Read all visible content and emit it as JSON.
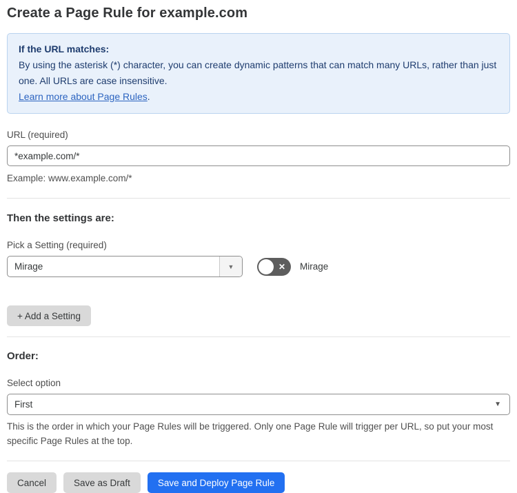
{
  "page": {
    "title": "Create a Page Rule for example.com"
  },
  "info_box": {
    "heading": "If the URL matches:",
    "body": "By using the asterisk (*) character, you can create dynamic patterns that can match many URLs, rather than just one. All URLs are case insensitive.",
    "link_text": "Learn more about Page Rules",
    "link_suffix": "."
  },
  "url_field": {
    "label": "URL (required)",
    "value": "*example.com/*",
    "helper": "Example: www.example.com/*"
  },
  "settings": {
    "heading": "Then the settings are:",
    "pick_label": "Pick a Setting (required)",
    "selected_setting": "Mirage",
    "toggle": {
      "state": "off",
      "label": "Mirage"
    },
    "add_button_label": "+ Add a Setting"
  },
  "order": {
    "heading": "Order:",
    "select_label": "Select option",
    "selected_option": "First",
    "helper": "This is the order in which your Page Rules will be triggered. Only one Page Rule will trigger per URL, so put your most specific Page Rules at the top."
  },
  "footer": {
    "cancel_label": "Cancel",
    "save_draft_label": "Save as Draft",
    "deploy_label": "Save and Deploy Page Rule"
  },
  "icons": {
    "caret_down": "▼",
    "toggle_off_x": "✕"
  },
  "colors": {
    "accent_blue": "#2270f1",
    "info_bg": "#e9f1fb",
    "info_border": "#b9d3ef",
    "info_text": "#1e3c6e",
    "link_blue": "#2c64c0",
    "toggle_off_gray": "#5d5d5d"
  }
}
